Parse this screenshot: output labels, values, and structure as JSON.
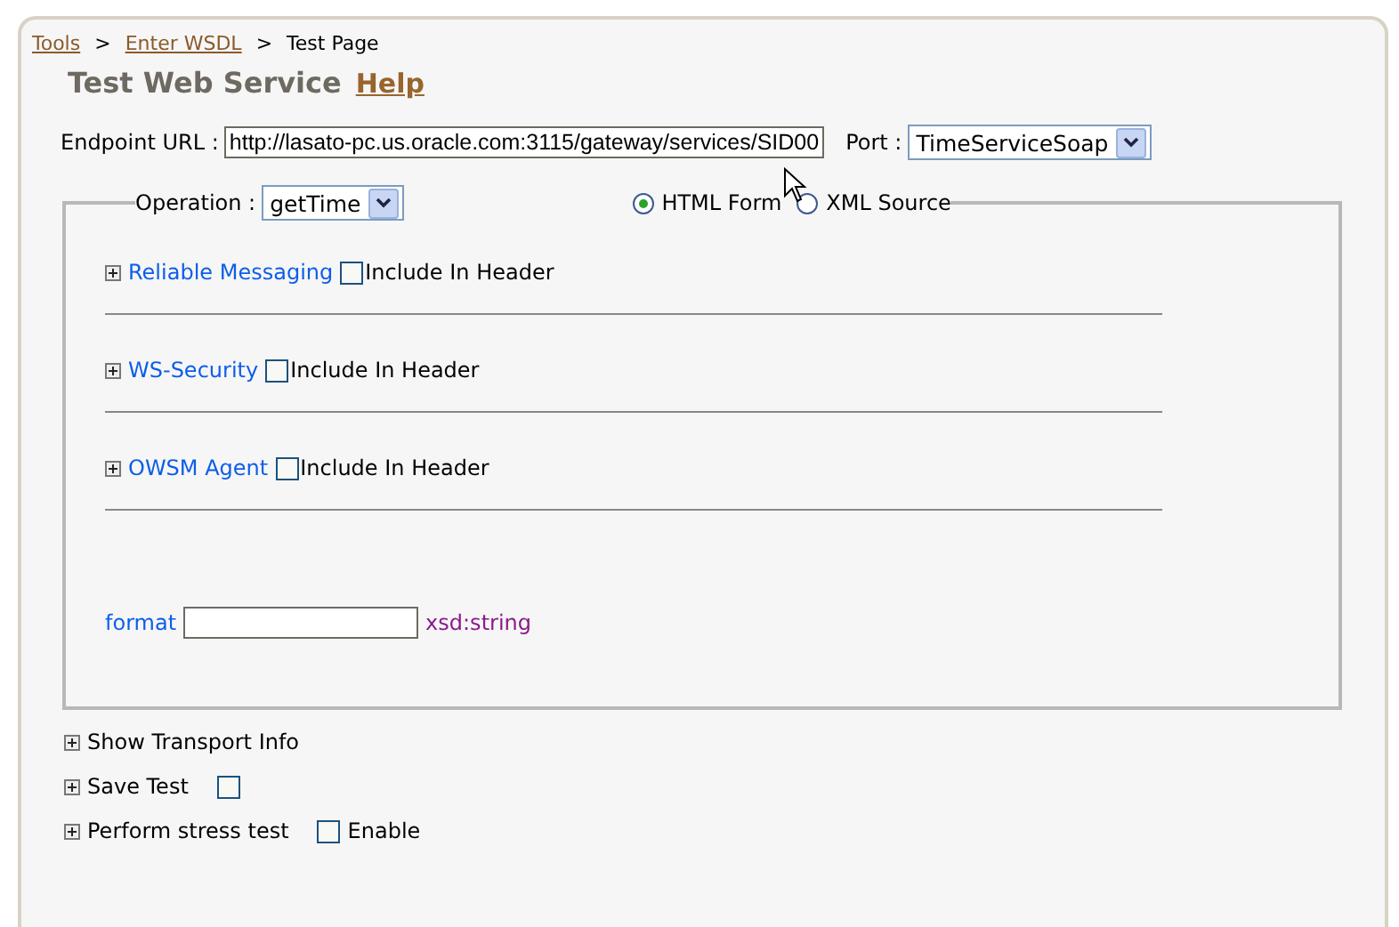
{
  "breadcrumbs": [
    {
      "kind": "link",
      "label": "Tools"
    },
    {
      "kind": "separator",
      "label": ">"
    },
    {
      "kind": "link",
      "label": "Enter WSDL"
    },
    {
      "kind": "separator",
      "label": ">"
    },
    {
      "kind": "current",
      "label": "Test Page"
    }
  ],
  "title": "Test Web Service",
  "help": "Help",
  "endpoint": {
    "label": "Endpoint URL :",
    "value": "http://lasato-pc.us.oracle.com:3115/gateway/services/SID00"
  },
  "port": {
    "label": "Port :",
    "value": "TimeServiceSoap"
  },
  "operation": {
    "label": "Operation :",
    "value": "getTime"
  },
  "modes": [
    {
      "label": "HTML Form",
      "selected": true
    },
    {
      "label": "XML Source",
      "selected": false
    }
  ],
  "headers": [
    {
      "label": "Reliable Messaging",
      "expanded": false,
      "checked": false,
      "include_label": "Include In Header"
    },
    {
      "label": "WS-Security",
      "expanded": false,
      "checked": false,
      "include_label": "Include In Header"
    },
    {
      "label": "OWSM Agent",
      "expanded": false,
      "checked": false,
      "include_label": "Include In Header"
    }
  ],
  "param": {
    "name": "format",
    "type": "xsd:string"
  },
  "options": [
    {
      "kind": "plain",
      "label": "Show Transport Info",
      "expanded": false
    },
    {
      "kind": "checkbox",
      "label": "Save Test",
      "expanded": false,
      "checked": false
    },
    {
      "kind": "checkbox",
      "label": "Perform stress test",
      "expanded": false,
      "checked": false,
      "check_label": "Enable"
    }
  ]
}
